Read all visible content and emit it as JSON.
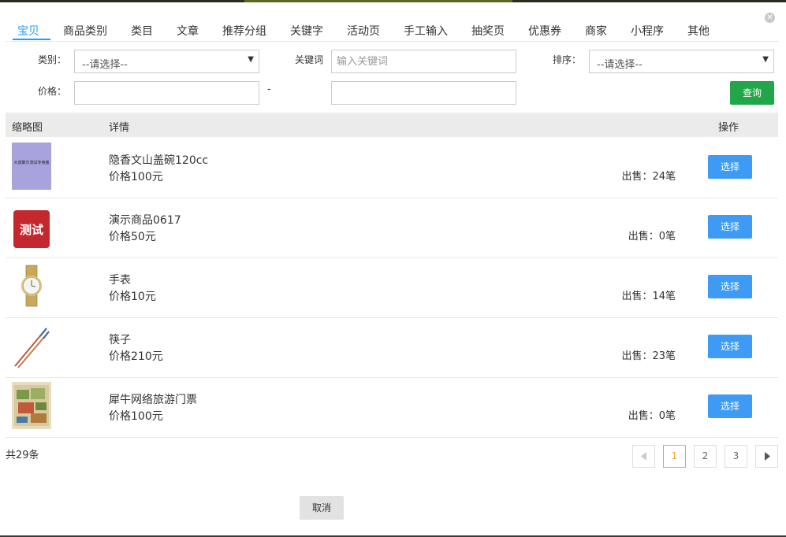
{
  "tabs": [
    "宝贝",
    "商品类别",
    "类目",
    "文章",
    "推荐分组",
    "关键字",
    "活动页",
    "手工输入",
    "抽奖页",
    "优惠券",
    "商家",
    "小程序",
    "其他"
  ],
  "active_tab_index": 0,
  "filters": {
    "category_label": "类别：",
    "category_value": "--请选择--",
    "keyword_label": "关键词",
    "keyword_placeholder": "输入关键词",
    "sort_label": "排序：",
    "sort_value": "--请选择--",
    "price_label": "价格：",
    "price_separator": "-",
    "query_label": "查询"
  },
  "table": {
    "headers": {
      "thumb": "缩略图",
      "detail": "详情",
      "action": "操作"
    },
    "rows": [
      {
        "name": "隐香文山盖碗120cc",
        "price": "价格100元",
        "sold": "出售：24笔",
        "thumb_icon": "book-cover-thumbnail",
        "thumb_text": "大成聚乐测试专用版"
      },
      {
        "name": "演示商品0617",
        "price": "价格50元",
        "sold": "出售：0笔",
        "thumb_icon": "red-test-thumbnail",
        "thumb_text": "测试"
      },
      {
        "name": "手表",
        "price": "价格10元",
        "sold": "出售：14笔",
        "thumb_icon": "watch-thumbnail"
      },
      {
        "name": "筷子",
        "price": "价格210元",
        "sold": "出售：23笔",
        "thumb_icon": "chopsticks-thumbnail"
      },
      {
        "name": "犀牛网络旅游门票",
        "price": "价格100元",
        "sold": "出售：0笔",
        "thumb_icon": "map-thumbnail"
      }
    ],
    "choose_label": "选择"
  },
  "pagination": {
    "total": "共29条",
    "pages": [
      "1",
      "2",
      "3"
    ],
    "current": "1"
  },
  "cancel_label": "取消",
  "colors": {
    "tab_active": "#1e9fff",
    "query_button": "#22a64a",
    "choose_button": "#3d9bf5",
    "page_active": "#f0a23c"
  }
}
